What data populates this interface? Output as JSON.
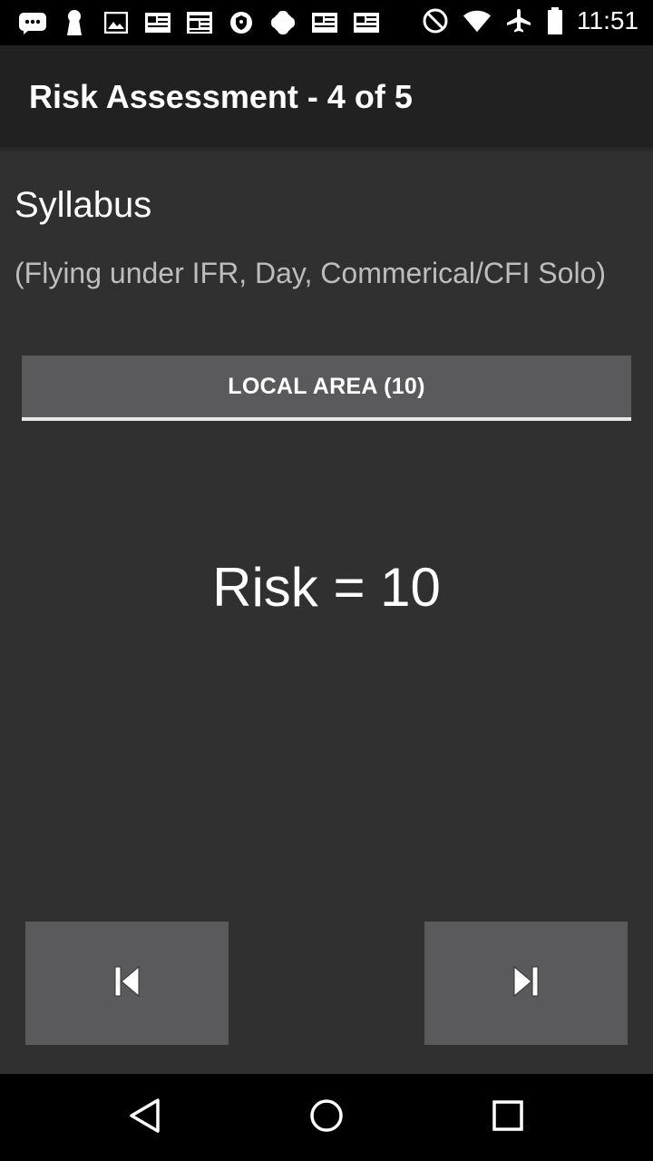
{
  "status_bar": {
    "time": "11:51",
    "left_icons": [
      "chat-icon",
      "keyhole-icon",
      "image-icon",
      "news-icon",
      "article-icon",
      "shield-icon",
      "android-icon",
      "news-icon",
      "news-icon"
    ],
    "right_icons": [
      "do-not-disturb-icon",
      "wifi-icon",
      "airplane-icon",
      "battery-icon"
    ]
  },
  "app_bar": {
    "title": "Risk Assessment - 4 of 5"
  },
  "content": {
    "section_title": "Syllabus",
    "section_subtitle": "(Flying under IFR, Day, Commerical/CFI Solo)",
    "category_button_label": "LOCAL AREA (10)",
    "risk_label": "Risk = 10"
  },
  "navigation": {
    "prev_icon": "skip-previous-icon",
    "next_icon": "skip-next-icon"
  },
  "system_nav": {
    "back_icon": "back-triangle-icon",
    "home_icon": "home-circle-icon",
    "recents_icon": "recents-square-icon"
  },
  "colors": {
    "background": "#303030",
    "app_bar": "#212121",
    "button": "#5a5a5c",
    "text_primary": "#ffffff",
    "text_secondary": "#bdbdbd"
  }
}
